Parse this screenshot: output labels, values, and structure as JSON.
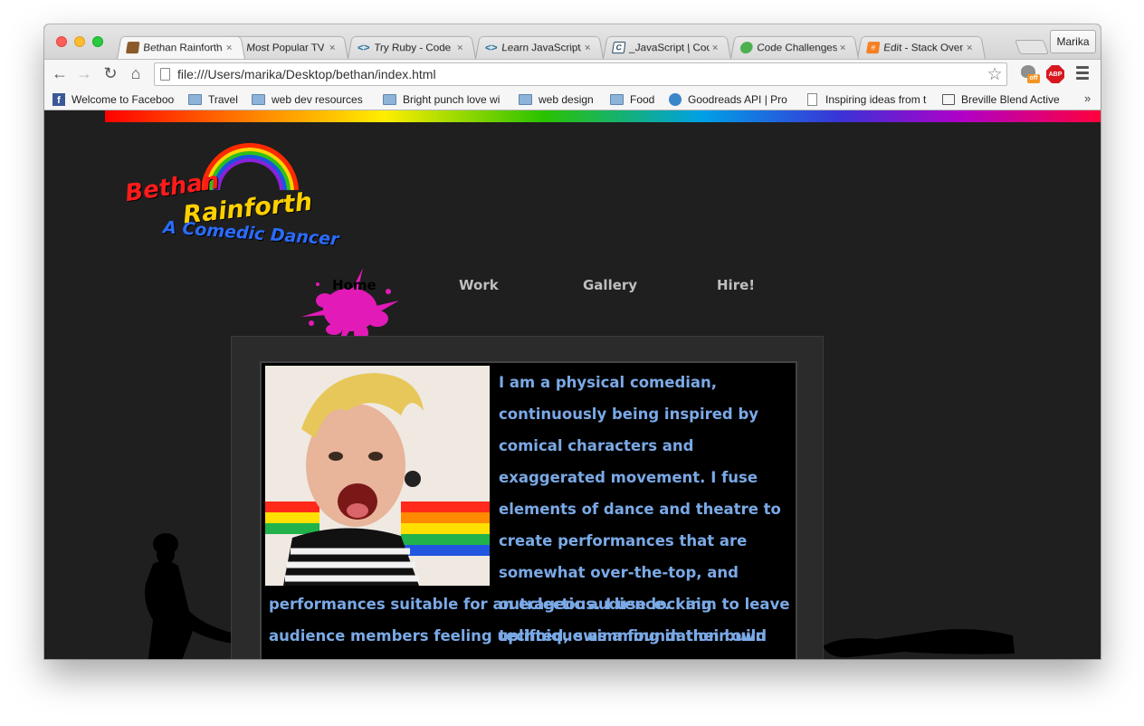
{
  "browser": {
    "tabs": [
      {
        "title": "Bethan Rainforth",
        "icon": "mask-icon",
        "active": true
      },
      {
        "title": "Most Popular TV",
        "icon": "tv-icon"
      },
      {
        "title": "Try Ruby - Code",
        "icon": "code-icon"
      },
      {
        "title": "Learn JavaScript",
        "icon": "code-icon"
      },
      {
        "title": "_JavaScript | Code",
        "icon": "codecademy-icon"
      },
      {
        "title": "Code Challenges",
        "icon": "hexagon-icon"
      },
      {
        "title": "Edit - Stack Over",
        "icon": "stackoverflow-icon"
      }
    ],
    "close_glyph": "×",
    "profile_name": "Marika",
    "url": "file:///Users/marika/Desktop/bethan/index.html",
    "abp_label": "ABP",
    "ext_off_label": "off",
    "bookmarks": [
      {
        "label": "Welcome to Facebook",
        "icon": "facebook-icon"
      },
      {
        "label": "Travel",
        "icon": "folder-icon"
      },
      {
        "label": "web dev resources",
        "icon": "folder-icon"
      },
      {
        "label": "Bright punch love wi",
        "icon": "folder-icon"
      },
      {
        "label": "web design",
        "icon": "folder-icon"
      },
      {
        "label": "Food",
        "icon": "folder-icon"
      },
      {
        "label": "Goodreads API | Pro",
        "icon": "puzzle-icon"
      },
      {
        "label": "Inspiring ideas from t",
        "icon": "document-icon"
      },
      {
        "label": "Breville Blend Active",
        "icon": "bag-icon"
      }
    ],
    "bookmarks_overflow": "»"
  },
  "site": {
    "logo": {
      "line1": "Bethan",
      "line2": "Rainforth",
      "line3": "A Comedic Dancer"
    },
    "nav": [
      {
        "label": "Home",
        "active": true
      },
      {
        "label": "Work"
      },
      {
        "label": "Gallery"
      },
      {
        "label": "Hire!"
      }
    ],
    "bio_side": "I am a physical comedian, continuously being inspired by comical characters and exaggerated movement. I fuse elements of dance and theatre to create performances that are somewhat over-the-top, and outrageous. I use locking technique as a foundation build and produce uproarious",
    "bio_full": "performances suitable for an eclectic audience. I aim to leave audience members feeling uplifted, swimming in their own tears of laughter.",
    "colors": {
      "accent": "#e21ab8",
      "text": "#7aa9e6",
      "background": "#1f1f1f"
    }
  }
}
